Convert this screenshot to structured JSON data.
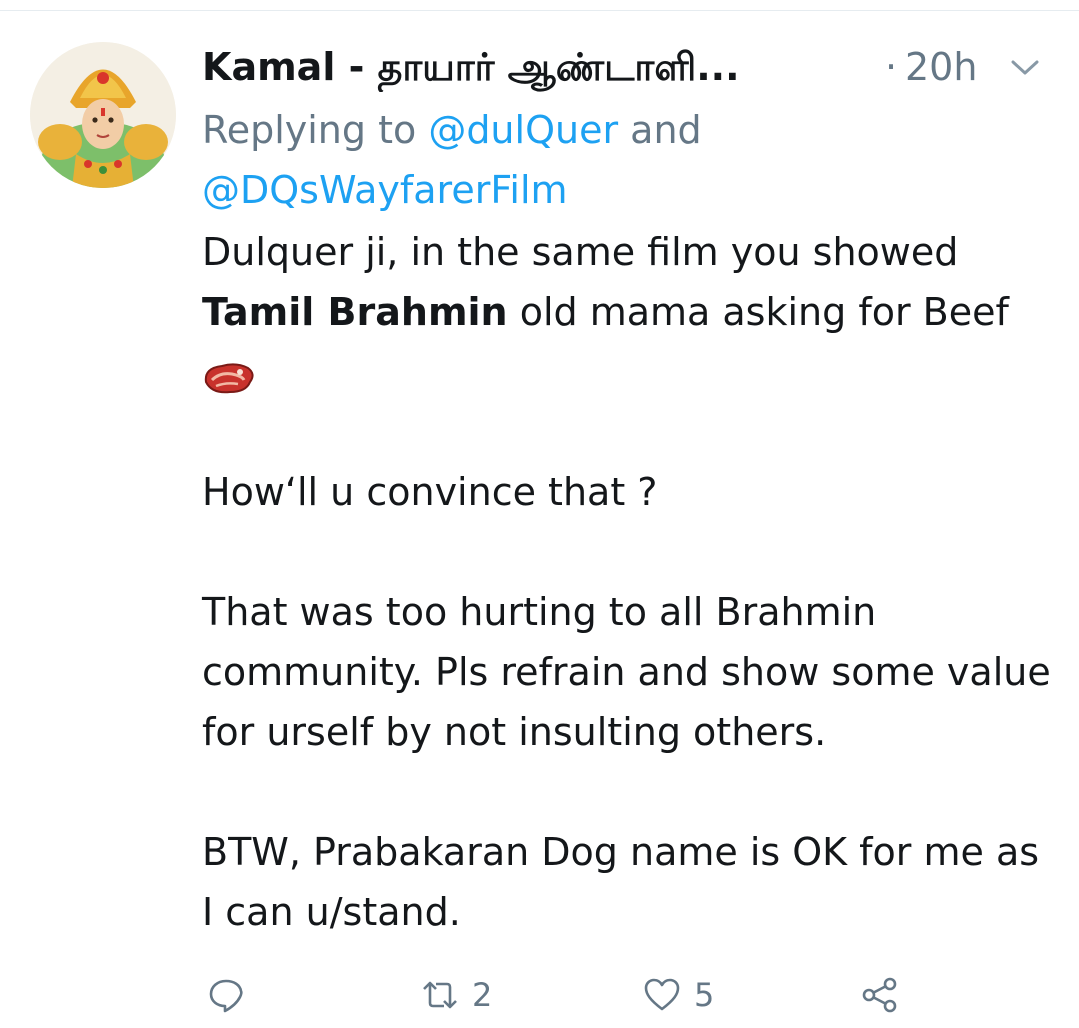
{
  "tweet": {
    "display_name": "Kamal - தாயார் ஆண்டாளி...",
    "dot": "·",
    "time": "20h",
    "reply_prefix": "Replying to ",
    "mention_1": "@dulQuer",
    "reply_and": " and ",
    "mention_2": "@DQsWayfarerFilm",
    "body": {
      "p1_start": "Dulquer ji, in the same film you showed ",
      "p1_bold": "Tamil Brahmin",
      "p1_end": " old mama asking for Beef",
      "p2": "How‘ll u convince that ?",
      "p3": "That was too hurting to all Brahmin community. Pls refrain and show some value for urself by not insulting others.",
      "p4": "BTW, Prabakaran Dog name is OK for me as I can u/stand."
    },
    "emoji": "cut-of-meat",
    "actions": {
      "reply_icon": "reply-icon",
      "retweet_icon": "retweet-icon",
      "retweet_count": "2",
      "like_icon": "heart-icon",
      "like_count": "5",
      "share_icon": "share-icon"
    }
  },
  "colors": {
    "text": "#14171a",
    "secondary": "#657786",
    "link": "#1da1f2"
  }
}
